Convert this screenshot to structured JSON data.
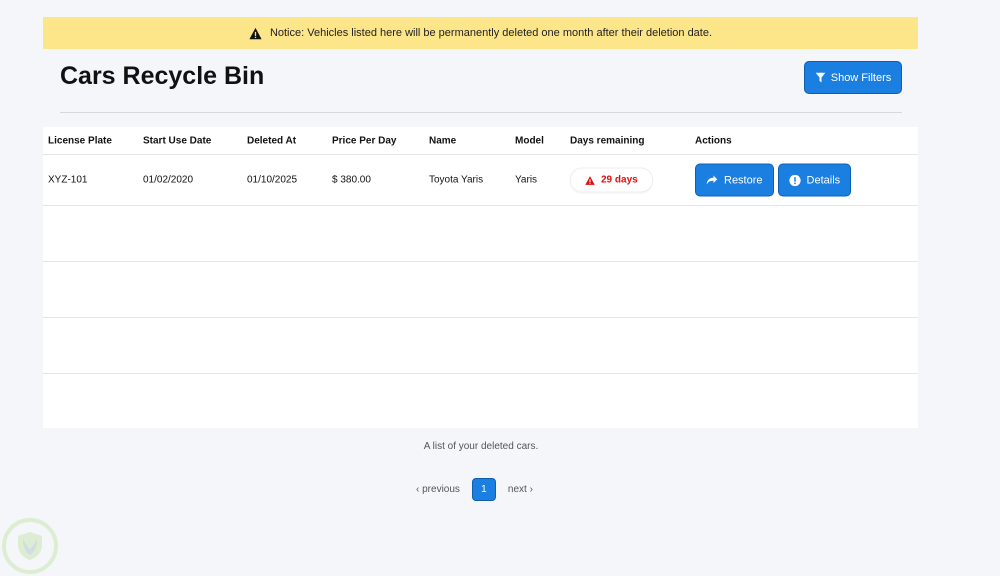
{
  "notice": {
    "text": "Notice: Vehicles listed here will be permanently deleted one month after their deletion date.",
    "icon": "warning-icon"
  },
  "header": {
    "title": "Cars Recycle Bin",
    "filters_label": "Show Filters"
  },
  "table": {
    "columns": [
      "License Plate",
      "Start Use Date",
      "Deleted At",
      "Price Per Day",
      "Name",
      "Model",
      "Days remaining",
      "Actions"
    ],
    "rows": [
      {
        "plate": "XYZ-101",
        "start": "01/02/2020",
        "deleted": "01/10/2025",
        "price": "$ 380.00",
        "name": "Toyota Yaris",
        "model": "Yaris",
        "days": "29 days",
        "restore": "Restore",
        "details": "Details"
      }
    ],
    "caption": "A list of your deleted cars."
  },
  "pagination": {
    "previous": "previous",
    "current": "1",
    "next": "next"
  },
  "colors": {
    "accent": "#1a7fe0",
    "notice_bg": "#fde68a",
    "danger": "#dd1111"
  }
}
